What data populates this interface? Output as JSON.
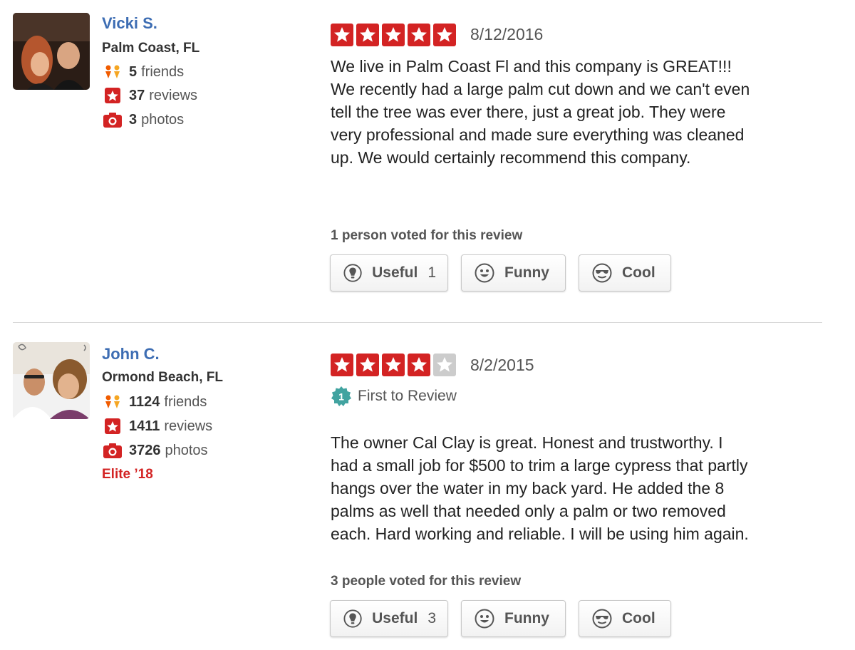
{
  "reviews": [
    {
      "user": {
        "name": "Vicki S.",
        "location": "Palm Coast, FL",
        "friends_count": "5",
        "friends_label": "friends",
        "reviews_count": "37",
        "reviews_label": "reviews",
        "photos_count": "3",
        "photos_label": "photos"
      },
      "rating": 5,
      "date": "8/12/2016",
      "text": "We live in Palm Coast Fl and this company is GREAT!!!\nWe recently had a large palm cut down and we  can't even\ntell the tree was ever there, just a great job.  They were\nvery professional and made sure everything was cleaned\nup.  We would certainly recommend this company.",
      "votes_label": "1 person voted for this review",
      "buttons": {
        "useful_label": "Useful",
        "useful_count": "1",
        "funny_label": "Funny",
        "cool_label": "Cool"
      }
    },
    {
      "user": {
        "name": "John C.",
        "location": "Ormond Beach, FL",
        "friends_count": "1124",
        "friends_label": "friends",
        "reviews_count": "1411",
        "reviews_label": "reviews",
        "photos_count": "3726",
        "photos_label": "photos",
        "elite": "Elite ’18"
      },
      "rating": 4,
      "date": "8/2/2015",
      "first_to_review": "First to Review",
      "text": "The owner Cal Clay is great.  Honest and trustworthy.  I\nhad a small job for $500 to trim a large cypress that partly\nhangs over the water in my back yard.  He added the 8\npalms as well that needed only a palm or two removed\neach.  Hard working and reliable.  I will be using him again.",
      "votes_label": "3 people voted for this review",
      "buttons": {
        "useful_label": "Useful",
        "useful_count": "3",
        "funny_label": "Funny",
        "cool_label": "Cool"
      }
    }
  ],
  "colors": {
    "accent_red": "#d32323",
    "user_link_blue": "#3d6db3",
    "star_empty": "#cccccc",
    "badge_teal": "#41a3a0"
  },
  "icons": {
    "friends": "friends-icon",
    "reviews": "review-star-icon",
    "photos": "camera-icon",
    "useful": "lightbulb-icon",
    "funny": "smiley-icon",
    "cool": "sunglasses-icon",
    "first_review": "first-review-badge-icon"
  }
}
